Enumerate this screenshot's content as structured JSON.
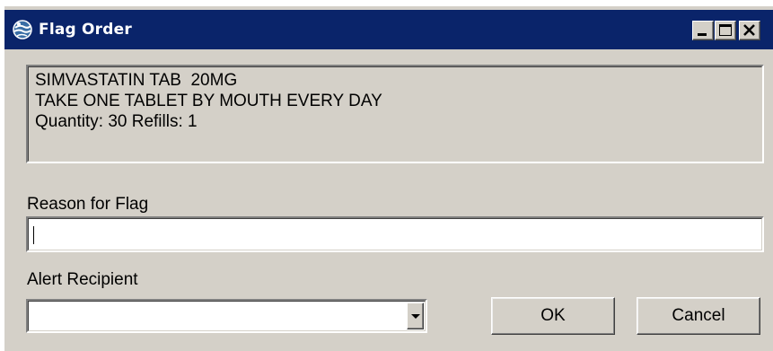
{
  "window": {
    "title": "Flag Order",
    "icon": "globe-app-icon",
    "title_bar_color": "#0a246a",
    "face_color": "#d4d0c8",
    "controls": [
      "minimize-icon",
      "maximize-icon",
      "close-icon"
    ]
  },
  "order": {
    "lines": [
      "SIMVASTATIN TAB  20MG",
      "TAKE ONE TABLET BY MOUTH EVERY DAY",
      "Quantity: 30 Refills: 1"
    ]
  },
  "reason": {
    "label": "Reason for Flag",
    "value": ""
  },
  "recipient": {
    "label": "Alert Recipient",
    "selected": ""
  },
  "buttons": {
    "ok_label": "OK",
    "cancel_label": "Cancel"
  }
}
